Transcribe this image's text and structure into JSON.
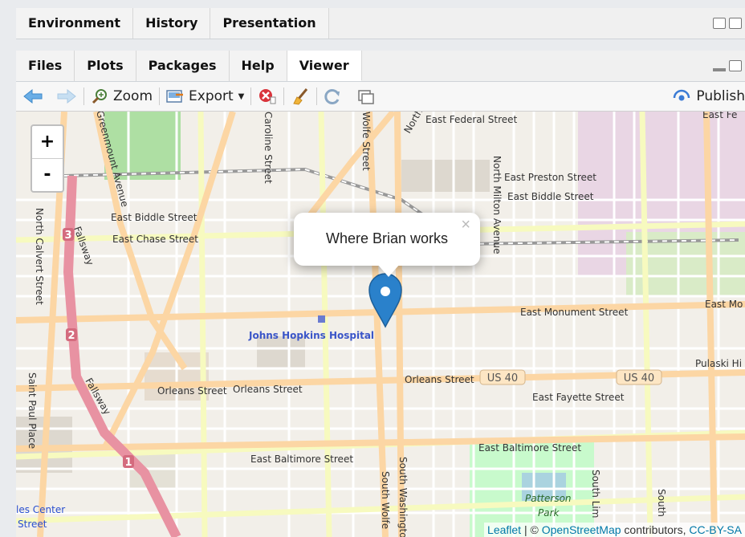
{
  "top_tabs": [
    "Environment",
    "History",
    "Presentation"
  ],
  "bottom_tabs": [
    "Files",
    "Plots",
    "Packages",
    "Help",
    "Viewer"
  ],
  "active_bottom_tab": "Viewer",
  "toolbar": {
    "zoom": "Zoom",
    "export": "Export",
    "publish": "Publish"
  },
  "map": {
    "zoom_in": "+",
    "zoom_out": "-",
    "popup_text": "Where Brian works",
    "popup_close": "×",
    "labels": {
      "east_federal": "East Federal Street",
      "east_preston": "East Preston Street",
      "east_biddle_r": "East Biddle Street",
      "east_biddle_l": "East Biddle Street",
      "east_chase": "East Chase Street",
      "east_monument": "East Monument Street",
      "east_mo": "East Mo",
      "johns_hopkins": "Johns Hopkins Hospital",
      "orleans_1": "Orleans Street",
      "orleans_2": "Orleans Street",
      "orleans_3": "Orleans Street",
      "us40_a": "US 40",
      "us40_b": "US 40",
      "east_fayette": "East Fayette Street",
      "east_baltimore_1": "East Baltimore Street",
      "east_baltimore_2": "East Baltimore Street",
      "pulaski": "Pulaski Hi",
      "patterson": "Patterson",
      "park": "Park",
      "north_calvert": "North Calvert Street",
      "fallsway_1": "Fallsway",
      "fallsway_2": "Fallsway",
      "saint_paul": "Saint Paul Place",
      "greenmount": "Greenmount Avenue",
      "caroline": "Caroline Street",
      "wolfe_n": "Wolfe Street",
      "north_w": "North",
      "north_milton": "North Milton Avenue",
      "south_wolfe": "South Wolfe",
      "south_washington": "South Washington",
      "south_lim": "South Lim",
      "south_e": "South",
      "les_center": "les Center",
      "street_bl": "Street",
      "east_fe": "East Fe",
      "shield_1": "1",
      "shield_2": "2",
      "shield_3": "3"
    },
    "attribution": {
      "leaflet": "Leaflet",
      "sep": " | © ",
      "osm": "OpenStreetMap",
      "contrib": " contributors, ",
      "license": "CC-BY-SA"
    }
  },
  "colors": {
    "marker": "#2a81cb",
    "water": "#aad3df",
    "park": "#c8facc",
    "road_major": "#fcd6a4",
    "road_trunk": "#e892a2"
  }
}
